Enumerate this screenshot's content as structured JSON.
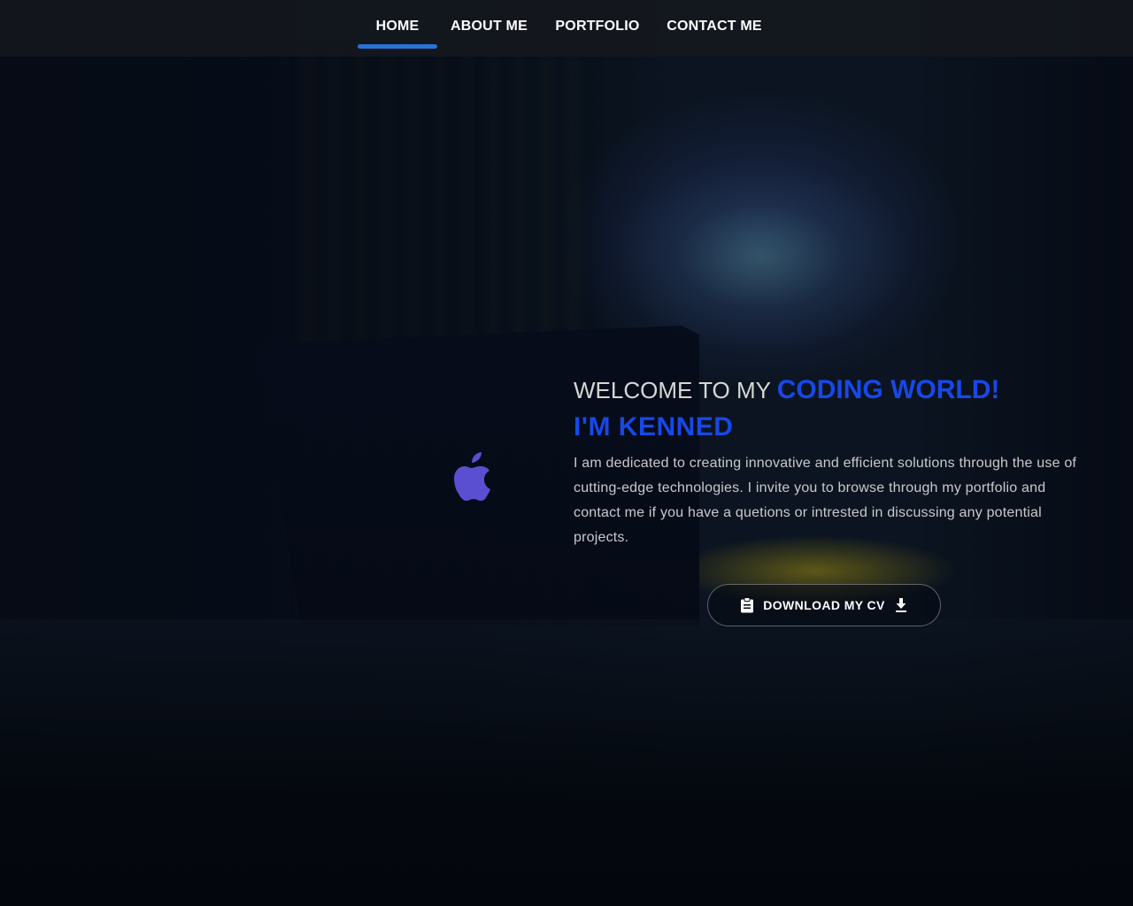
{
  "nav": {
    "items": [
      {
        "label": "HOME",
        "active": true
      },
      {
        "label": "ABOUT ME",
        "active": false
      },
      {
        "label": "PORTFOLIO",
        "active": false
      },
      {
        "label": "CONTACT ME",
        "active": false
      }
    ],
    "active_color": "#2874d6"
  },
  "hero": {
    "welcome_prefix": "WELCOME TO MY",
    "welcome_accent": "CODING WORLD!",
    "name": "I'M KENNED",
    "intro": "I am dedicated to creating innovative and efficient solutions through the use of cutting-edge technologies. I invite you to browse through my portfolio and contact me if you have a quetions or intrested in discussing any potential projects.",
    "accent_color": "#1748e8"
  },
  "cv_button": {
    "label": "DOWNLOAD MY CV",
    "left_icon": "clipboard-icon",
    "right_icon": "download-icon"
  },
  "background": {
    "logo_icon": "apple-logo-icon"
  }
}
